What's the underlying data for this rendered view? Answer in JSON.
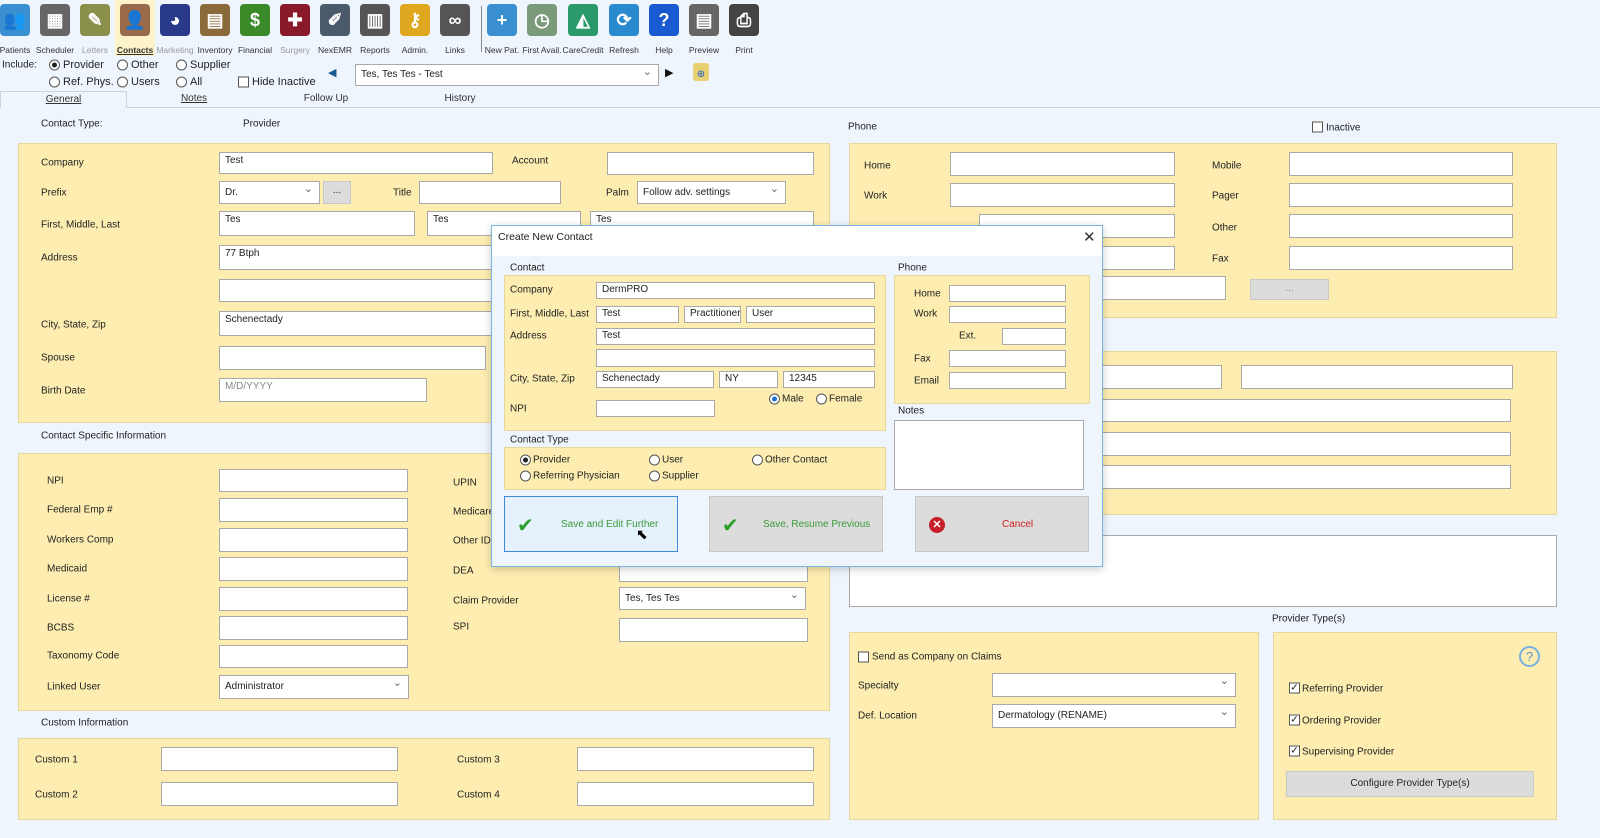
{
  "toolbar": {
    "items": [
      {
        "label": "Patients",
        "icon": "patients-icon",
        "color": "#3a8fd0"
      },
      {
        "label": "Scheduler",
        "icon": "calendar-icon",
        "color": "#666"
      },
      {
        "label": "Letters",
        "icon": "letters-icon",
        "color": "#8a8f4a",
        "disabled": true
      },
      {
        "label": "Contacts",
        "icon": "contacts-icon",
        "color": "#9a6b4b",
        "active": true
      },
      {
        "label": "Marketing",
        "icon": "pie-chart-icon",
        "color": "#2a3a8a",
        "disabled": true
      },
      {
        "label": "Inventory",
        "icon": "hand-truck-icon",
        "color": "#8a6a3a"
      },
      {
        "label": "Financial",
        "icon": "money-icon",
        "color": "#3a8a2a"
      },
      {
        "label": "Surgery",
        "icon": "medical-cross-icon",
        "color": "#8a1a2a",
        "disabled": true
      },
      {
        "label": "NexEMR",
        "icon": "tablet-icon",
        "color": "#4a5a6a"
      },
      {
        "label": "Reports",
        "icon": "report-icon",
        "color": "#555"
      },
      {
        "label": "Admin.",
        "icon": "key-icon",
        "color": "#e0a820"
      },
      {
        "label": "Links",
        "icon": "link-icon",
        "color": "#555"
      },
      {
        "label": "New Pat.",
        "icon": "add-patient-icon",
        "color": "#3a8fd0"
      },
      {
        "label": "First Avail.",
        "icon": "first-available-icon",
        "color": "#7a9a7a"
      },
      {
        "label": "CareCredit",
        "icon": "carecredit-icon",
        "color": "#2a9a6a"
      },
      {
        "label": "Refresh",
        "icon": "refresh-icon",
        "color": "#2a8ad0"
      },
      {
        "label": "Help",
        "icon": "help-icon",
        "color": "#1a5ad0"
      },
      {
        "label": "Preview",
        "icon": "preview-icon",
        "color": "#666"
      },
      {
        "label": "Print",
        "icon": "print-icon",
        "color": "#444"
      }
    ]
  },
  "include": {
    "label": "Include:",
    "options": [
      "Provider",
      "Other",
      "Supplier",
      "Ref. Phys.",
      "Users",
      "All"
    ],
    "selected": "Provider",
    "hide_inactive": "Hide Inactive",
    "contact_select": "Tes, Tes Tes  - Test"
  },
  "tabs": [
    "General",
    "Notes",
    "Follow Up",
    "History"
  ],
  "general": {
    "contact_type_label": "Contact Type:",
    "contact_type_value": "Provider",
    "company": "Company",
    "company_value": "Test",
    "account": "Account",
    "prefix": "Prefix",
    "prefix_value": "Dr.",
    "ellipsis": "...",
    "title": "Title",
    "palm": "Palm",
    "palm_value": "Follow adv. settings",
    "name": "First, Middle, Last",
    "first": "Tes",
    "middle": "Tes",
    "last": "Tes",
    "address": "Address",
    "address_value": "77 Btph",
    "city": "City, State, Zip",
    "city_value": "Schenectady",
    "spouse": "Spouse",
    "birth": "Birth Date",
    "birth_placeholder": "M/D/YYYY",
    "csi_label": "Contact Specific Information",
    "npi": "NPI",
    "federal": "Federal Emp #",
    "workers": "Workers Comp",
    "medicaid": "Medicaid",
    "license": "License #",
    "bcbs": "BCBS",
    "taxonomy": "Taxonomy Code",
    "linked_user": "Linked User",
    "linked_user_value": "Administrator",
    "upin": "UPIN",
    "medicare": "Medicare",
    "other_id": "Other ID",
    "dea": "DEA",
    "claim_provider": "Claim Provider",
    "claim_provider_value": "Tes, Tes Tes",
    "spi": "SPI",
    "custom_label": "Custom Information",
    "custom1": "Custom 1",
    "custom2": "Custom 2",
    "custom3": "Custom 3",
    "custom4": "Custom 4",
    "phone_label": "Phone",
    "inactive": "Inactive",
    "home": "Home",
    "work": "Work",
    "mobile": "Mobile",
    "pager": "Pager",
    "other": "Other",
    "fax": "Fax",
    "send_company": "Send as Company on Claims",
    "specialty": "Specialty",
    "def_location": "Def. Location",
    "def_location_value": "Dermatology (RENAME)",
    "provider_types_label": "Provider Type(s)",
    "referring": "Referring Provider",
    "ordering": "Ordering Provider",
    "supervising": "Supervising Provider",
    "configure": "Configure Provider Type(s)"
  },
  "dialog": {
    "title": "Create New Contact",
    "contact_label": "Contact",
    "company": "Company",
    "company_value": "DermPRO",
    "name": "First, Middle, Last",
    "first": "Test",
    "middle": "Practitioner",
    "last": "User",
    "address": "Address",
    "address_value": "Test",
    "city": "City, State, Zip",
    "city_value": "Schenectady",
    "state_value": "NY",
    "zip_value": "12345",
    "male": "Male",
    "female": "Female",
    "npi": "NPI",
    "contact_type_label": "Contact Type",
    "types": [
      "Provider",
      "User",
      "Other Contact",
      "Referring Physician",
      "Supplier"
    ],
    "phone_label": "Phone",
    "home": "Home",
    "work": "Work",
    "ext": "Ext.",
    "fax": "Fax",
    "email": "Email",
    "notes": "Notes",
    "save_edit": "Save and Edit Further",
    "save_resume": "Save, Resume Previous",
    "cancel": "Cancel"
  }
}
